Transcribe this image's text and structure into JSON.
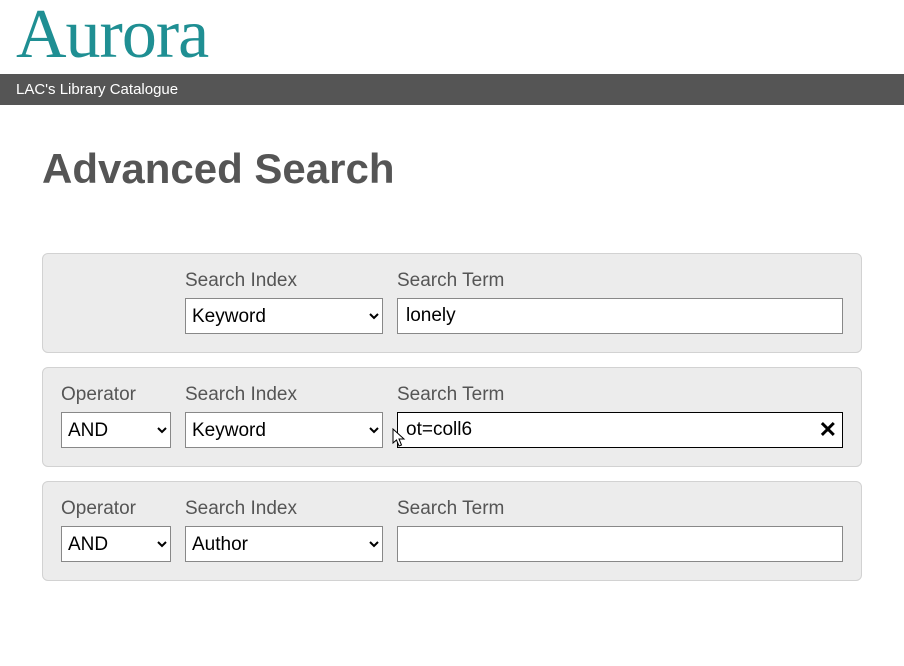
{
  "logo": "Aurora",
  "menubar": {
    "title": "LAC's Library Catalogue"
  },
  "page": {
    "heading": "Advanced Search"
  },
  "labels": {
    "operator": "Operator",
    "index": "Search Index",
    "term": "Search Term"
  },
  "rows": [
    {
      "operator": null,
      "index": "Keyword",
      "term": "lonely",
      "clearable": false
    },
    {
      "operator": "AND",
      "index": "Keyword",
      "term": "ot=coll6",
      "clearable": true
    },
    {
      "operator": "AND",
      "index": "Author",
      "term": "",
      "clearable": false
    }
  ],
  "icons": {
    "clear": "✕"
  }
}
